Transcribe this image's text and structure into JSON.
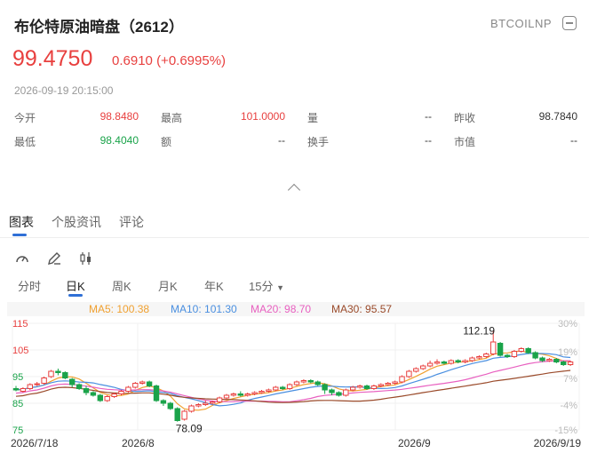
{
  "header": {
    "title": "布伦特原油暗盘（2612）",
    "code": "BTCOILNP",
    "price": "99.4750",
    "change": "0.6910",
    "change_pct": "(+0.6995%)",
    "timestamp": "2026-09-19 20:15:00"
  },
  "stats": {
    "row1": [
      {
        "label": "今开",
        "value": "98.8480"
      },
      {
        "label": "最高",
        "value": "101.0000"
      },
      {
        "label": "量",
        "value": "--"
      },
      {
        "label": "昨收",
        "value": "98.7840"
      }
    ],
    "row2": [
      {
        "label": "最低",
        "value": "98.4040"
      },
      {
        "label": "额",
        "value": "--"
      },
      {
        "label": "换手",
        "value": "--"
      },
      {
        "label": "市值",
        "value": "--"
      }
    ]
  },
  "tabs": [
    "图表",
    "个股资讯",
    "评论"
  ],
  "tools": [
    "gauge-icon",
    "draw-pen-icon",
    "candlestick-icon"
  ],
  "periods": [
    "分时",
    "日K",
    "周K",
    "月K",
    "年K",
    "15分"
  ],
  "ma": {
    "ma5": "MA5: 100.38",
    "ma10": "MA10: 101.30",
    "ma20": "MA20: 98.70",
    "ma30": "MA30: 95.57"
  },
  "colors": {
    "up": "#e8403f",
    "down": "#1aa34a",
    "ma5": "#f0a030",
    "ma10": "#4a8fe0",
    "ma20": "#e860c0",
    "ma30": "#9a4a2a"
  },
  "chart_data": {
    "type": "candlestick",
    "y_ticks": [
      "115",
      "105",
      "95",
      "85",
      "75"
    ],
    "pct_ticks": [
      "30%",
      "19%",
      "7%",
      "-4%",
      "-15%"
    ],
    "x_ticks": [
      "2026/7/18",
      "2026/8",
      "2026/9",
      "2026/9/19"
    ],
    "annotations": {
      "high": "112.19",
      "low": "78.09"
    },
    "ylim": [
      75,
      115
    ],
    "candles": [
      [
        90.5,
        90,
        91.5,
        89.5
      ],
      [
        89.5,
        90.5,
        91,
        89
      ],
      [
        90.5,
        92,
        92.5,
        90
      ],
      [
        92,
        92.3,
        93,
        91.5
      ],
      [
        92.5,
        94.5,
        95,
        92
      ],
      [
        95,
        97,
        97.5,
        94.5
      ],
      [
        97,
        96.5,
        98,
        95.5
      ],
      [
        96.5,
        94.5,
        97,
        94
      ],
      [
        94,
        92,
        94.5,
        91
      ],
      [
        92,
        90.5,
        92.5,
        90
      ],
      [
        90.5,
        89,
        91.5,
        88
      ],
      [
        89,
        88,
        89.5,
        87.5
      ],
      [
        88,
        86,
        88.5,
        85.5
      ],
      [
        86,
        87.5,
        88,
        85.5
      ],
      [
        87.5,
        88.5,
        89,
        87
      ],
      [
        88.5,
        89.5,
        90,
        88
      ],
      [
        89.5,
        91,
        91.5,
        89
      ],
      [
        91,
        92.5,
        93,
        90.5
      ],
      [
        92.5,
        93,
        93.5,
        92
      ],
      [
        93,
        91.5,
        93.5,
        91
      ],
      [
        91.5,
        86,
        92,
        85.5
      ],
      [
        86,
        85,
        86.5,
        84
      ],
      [
        85,
        83,
        85.5,
        82.5
      ],
      [
        83,
        78.5,
        83.5,
        78.09
      ],
      [
        79,
        82,
        82.5,
        78.5
      ],
      [
        82,
        84,
        84.5,
        81.5
      ],
      [
        84,
        84.5,
        85,
        83.5
      ],
      [
        84.5,
        85,
        86,
        84
      ],
      [
        85,
        85.5,
        86,
        84.5
      ],
      [
        85.5,
        87,
        87.5,
        85
      ],
      [
        87,
        88,
        88.5,
        86.5
      ],
      [
        88,
        88.5,
        89,
        87.5
      ],
      [
        88.5,
        88,
        89.5,
        87.5
      ],
      [
        88,
        88.5,
        89,
        87.5
      ],
      [
        88.5,
        89,
        89.5,
        88
      ],
      [
        89,
        89.5,
        90,
        88.5
      ],
      [
        89.5,
        90,
        90.5,
        89
      ],
      [
        90,
        91,
        91.5,
        89.5
      ],
      [
        91,
        90.5,
        91.5,
        90
      ],
      [
        90.5,
        92,
        92.5,
        90
      ],
      [
        92,
        93,
        93.5,
        91.5
      ],
      [
        93,
        93.5,
        94,
        92.5
      ],
      [
        93.5,
        93,
        94,
        92.5
      ],
      [
        93,
        92,
        93.5,
        91.5
      ],
      [
        92,
        90,
        92.5,
        88.5
      ],
      [
        90,
        89,
        90.5,
        88
      ],
      [
        89,
        88,
        89.5,
        87.5
      ],
      [
        88,
        90,
        90.5,
        87.5
      ],
      [
        90,
        91,
        91.5,
        89.5
      ],
      [
        91,
        91.5,
        92,
        90.5
      ],
      [
        91.5,
        90.5,
        92,
        90
      ],
      [
        90.5,
        91.5,
        92,
        90
      ],
      [
        91.5,
        92,
        92.5,
        91
      ],
      [
        92,
        92.5,
        93,
        91.5
      ],
      [
        92.5,
        93,
        93.5,
        92
      ],
      [
        93,
        95,
        95.5,
        92.5
      ],
      [
        95,
        97,
        97.5,
        94.5
      ],
      [
        97,
        98,
        98.5,
        96.5
      ],
      [
        98,
        99,
        99.5,
        97.5
      ],
      [
        99,
        100,
        101,
        98.5
      ],
      [
        100,
        100.5,
        101.5,
        99.5
      ],
      [
        100.5,
        100,
        101,
        99.5
      ],
      [
        100,
        101,
        101.5,
        99.5
      ],
      [
        101,
        100.5,
        101.5,
        100
      ],
      [
        100.5,
        101,
        101.5,
        100
      ],
      [
        101,
        102,
        102.5,
        100.5
      ],
      [
        102,
        102.5,
        103,
        101.5
      ],
      [
        102.5,
        103.5,
        104,
        102
      ],
      [
        103.5,
        108,
        112.19,
        103
      ],
      [
        107.5,
        103,
        108,
        102.5
      ],
      [
        103,
        102.5,
        103.5,
        102
      ],
      [
        102.5,
        104.5,
        105,
        102
      ],
      [
        104.5,
        105.5,
        106,
        104
      ],
      [
        105.5,
        104,
        106,
        103.5
      ],
      [
        104,
        102,
        104.5,
        101.5
      ],
      [
        102,
        101,
        102.5,
        100.5
      ],
      [
        101,
        101.5,
        102,
        100.5
      ],
      [
        101.5,
        100.5,
        102,
        100
      ],
      [
        100.5,
        99.5,
        101,
        99
      ],
      [
        99.5,
        100.5,
        101,
        99
      ]
    ]
  }
}
